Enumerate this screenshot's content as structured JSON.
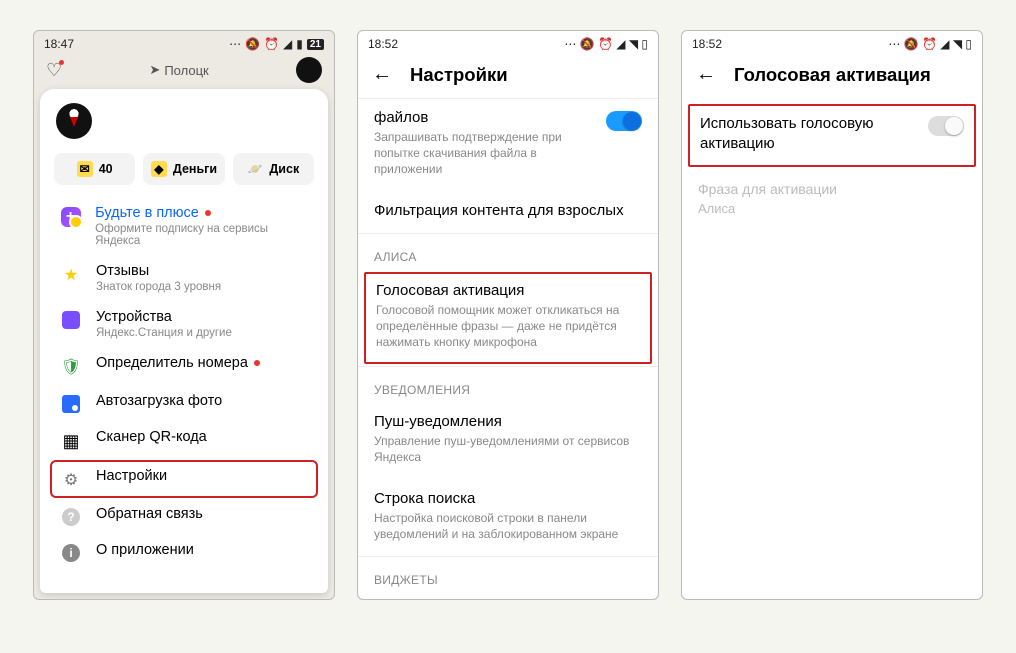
{
  "phone1": {
    "time": "18:47",
    "status_num": "21",
    "location_label": "Полоцк",
    "chips": {
      "mail_count": "40",
      "money": "Деньги",
      "disk": "Диск"
    },
    "menu": {
      "plus_title": "Будьте в плюсе",
      "plus_sub": "Оформите подписку на сервисы Яндекса",
      "reviews_title": "Отзывы",
      "reviews_sub": "Знаток города 3 уровня",
      "devices_title": "Устройства",
      "devices_sub": "Яндекс.Станция и другие",
      "callerid_title": "Определитель номера",
      "autoupload_title": "Автозагрузка фото",
      "qr_title": "Сканер QR-кода",
      "settings_title": "Настройки",
      "feedback_title": "Обратная связь",
      "about_title": "О приложении"
    }
  },
  "phone2": {
    "time": "18:52",
    "header": "Настройки",
    "files_title": "файлов",
    "files_sub": "Запрашивать подтверждение при попытке скачивания файла в приложении",
    "filter_title": "Фильтрация контента для взрослых",
    "section_alisa": "АЛИСА",
    "voice_title": "Голосовая активация",
    "voice_sub": "Голосовой помощник может откликаться на определённые фразы — даже не придётся нажимать кнопку микрофона",
    "section_notif": "УВЕДОМЛЕНИЯ",
    "push_title": "Пуш-уведомления",
    "push_sub": "Управление пуш-уведомлениями от сервисов Яндекса",
    "search_title": "Строка поиска",
    "search_sub": "Настройка поисковой строки в панели уведомлений и на заблокированном экране",
    "section_widgets": "ВИДЖЕТЫ"
  },
  "phone3": {
    "time": "18:52",
    "header": "Голосовая активация",
    "use_voice_title": "Использовать голосовую активацию",
    "phrase_label": "Фраза для активации",
    "phrase_value": "Алиса"
  }
}
